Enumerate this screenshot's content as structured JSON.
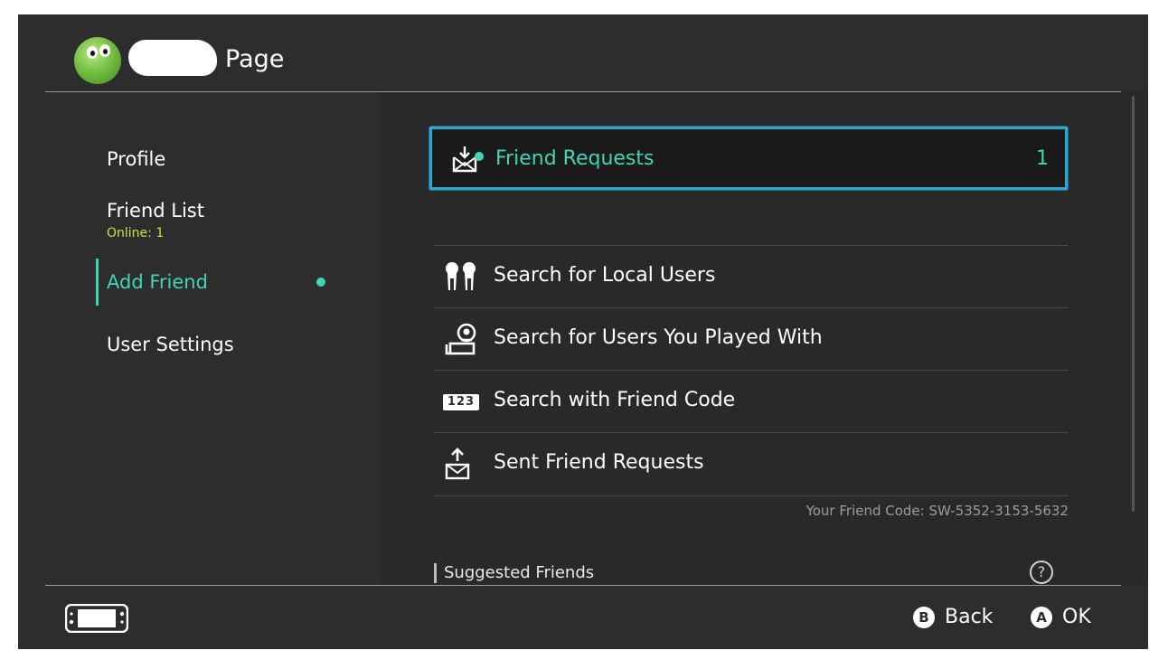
{
  "header": {
    "title": "Page"
  },
  "sidebar": {
    "items": [
      {
        "label": "Profile"
      },
      {
        "label": "Friend List",
        "sublabel": "Online: 1"
      },
      {
        "label": "Add Friend"
      },
      {
        "label": "User Settings"
      }
    ]
  },
  "main": {
    "friend_requests": {
      "label": "Friend Requests",
      "count": "1"
    },
    "menu": [
      {
        "label": "Search for Local Users",
        "icon": "local-users-icon"
      },
      {
        "label": "Search for Users You Played With",
        "icon": "played-with-icon"
      },
      {
        "label": "Search with Friend Code",
        "icon": "friend-code-123-icon"
      },
      {
        "label": "Sent Friend Requests",
        "icon": "sent-requests-icon"
      }
    ],
    "friend_code": "Your Friend Code: SW-5352-3153-5632",
    "suggested_label": "Suggested Friends",
    "icon_123_text": "123"
  },
  "footer": {
    "back": {
      "button": "B",
      "label": "Back"
    },
    "ok": {
      "button": "A",
      "label": "OK"
    }
  },
  "colors": {
    "accent": "#3fd6b6",
    "selection_border": "#2fa6cf",
    "online": "#c8e03b",
    "background": "#2d2d2d"
  }
}
